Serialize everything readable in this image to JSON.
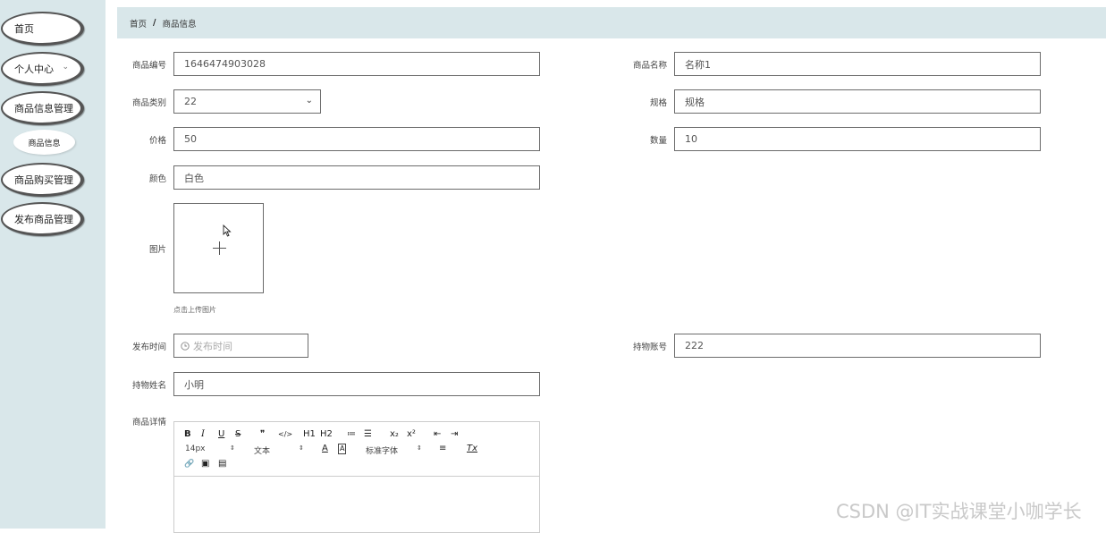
{
  "sidebar": {
    "items": [
      {
        "label": "首页"
      },
      {
        "label": "个人中心",
        "chevron": "⌄"
      },
      {
        "label": "商品信息管理"
      },
      {
        "label": "商品购买管理"
      },
      {
        "label": "发布商品管理"
      }
    ],
    "sub_item": {
      "label": "商品信息"
    }
  },
  "breadcrumb": {
    "home": "首页",
    "separator": "/",
    "current": "商品信息"
  },
  "form": {
    "product_code": {
      "label": "商品编号",
      "value": "1646474903028"
    },
    "product_name": {
      "label": "商品名称",
      "value": "名称1"
    },
    "category": {
      "label": "商品类别",
      "value": "22"
    },
    "spec": {
      "label": "规格",
      "value": "规格"
    },
    "price": {
      "label": "价格",
      "value": "50"
    },
    "quantity": {
      "label": "数量",
      "value": "10"
    },
    "color": {
      "label": "颜色",
      "value": "白色"
    },
    "image": {
      "label": "图片",
      "hint": "点击上传图片"
    },
    "publish_time": {
      "label": "发布时间",
      "placeholder": "发布时间"
    },
    "holder_account": {
      "label": "持物账号",
      "value": "222"
    },
    "holder_name": {
      "label": "持物姓名",
      "value": "小明"
    },
    "details": {
      "label": "商品详情"
    }
  },
  "editor_toolbar": {
    "row1": [
      "B",
      "I",
      "U",
      "S",
      "❞",
      "</>",
      "H1",
      "H2",
      "≔",
      "☰",
      "x₂",
      "x²",
      "⇤",
      "⇥"
    ],
    "font_size": "14px",
    "text_style": "文本",
    "font_family": "标准字体",
    "font_color": "A",
    "bg_color": "A",
    "align": "≡",
    "clear": "Tx",
    "row3": [
      "🔗",
      "▣",
      "▤"
    ]
  },
  "watermark": "CSDN @IT实战课堂小咖学长",
  "colors": {
    "sidebar_bg": "#d9e7ea",
    "breadcrumb_bg": "#d9e7ea",
    "input_border": "#6b6b6b"
  }
}
